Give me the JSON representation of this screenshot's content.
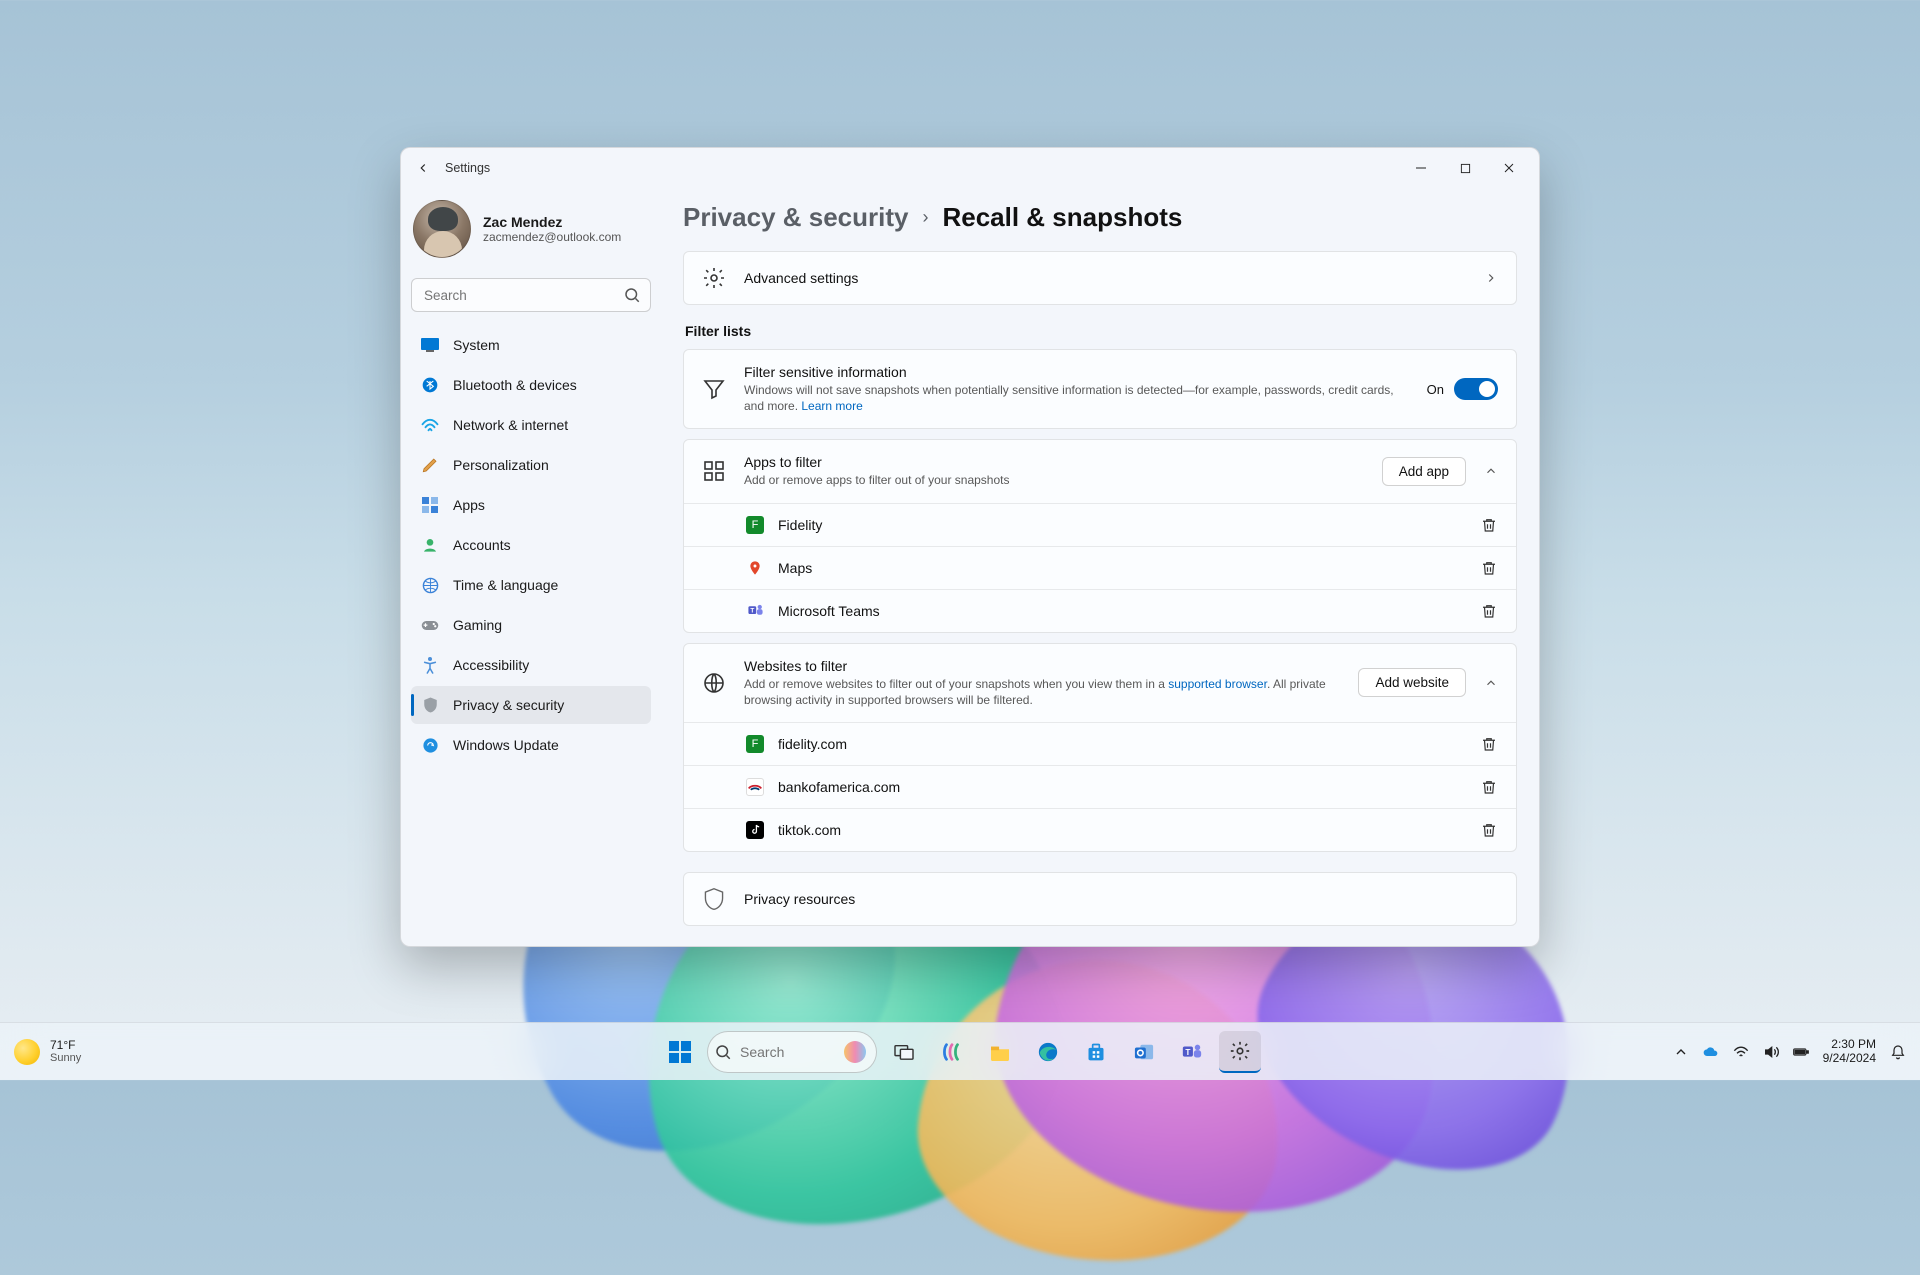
{
  "taskbar": {
    "weather": {
      "temp": "71°F",
      "cond": "Sunny"
    },
    "search_placeholder": "Search",
    "clock": {
      "time": "2:30 PM",
      "date": "9/24/2024"
    }
  },
  "window": {
    "title": "Settings",
    "user": {
      "name": "Zac Mendez",
      "email": "zacmendez@outlook.com"
    },
    "search_placeholder": "Search",
    "nav": [
      {
        "label": "System"
      },
      {
        "label": "Bluetooth & devices"
      },
      {
        "label": "Network & internet"
      },
      {
        "label": "Personalization"
      },
      {
        "label": "Apps"
      },
      {
        "label": "Accounts"
      },
      {
        "label": "Time & language"
      },
      {
        "label": "Gaming"
      },
      {
        "label": "Accessibility"
      },
      {
        "label": "Privacy & security"
      },
      {
        "label": "Windows Update"
      }
    ],
    "breadcrumb": {
      "parent": "Privacy & security",
      "current": "Recall & snapshots"
    },
    "advanced_label": "Advanced settings",
    "filter_lists_label": "Filter lists",
    "filter_sensitive": {
      "title": "Filter sensitive information",
      "desc": "Windows will not save snapshots when potentially sensitive information is detected—for example, passwords, credit cards, and more. ",
      "learn_more": "Learn more",
      "state": "On"
    },
    "apps_to_filter": {
      "title": "Apps to filter",
      "desc": "Add or remove apps to filter out of your snapshots",
      "add_btn": "Add app",
      "items": [
        {
          "label": "Fidelity"
        },
        {
          "label": "Maps"
        },
        {
          "label": "Microsoft Teams"
        }
      ]
    },
    "websites_to_filter": {
      "title": "Websites to filter",
      "desc_pre": "Add or remove websites to filter out of your snapshots when you view them in a ",
      "desc_link": "supported browser",
      "desc_post": ". All private browsing activity in supported browsers will be filtered.",
      "add_btn": "Add website",
      "items": [
        {
          "label": "fidelity.com"
        },
        {
          "label": "bankofamerica.com"
        },
        {
          "label": "tiktok.com"
        }
      ]
    },
    "privacy_resources_label": "Privacy resources"
  }
}
